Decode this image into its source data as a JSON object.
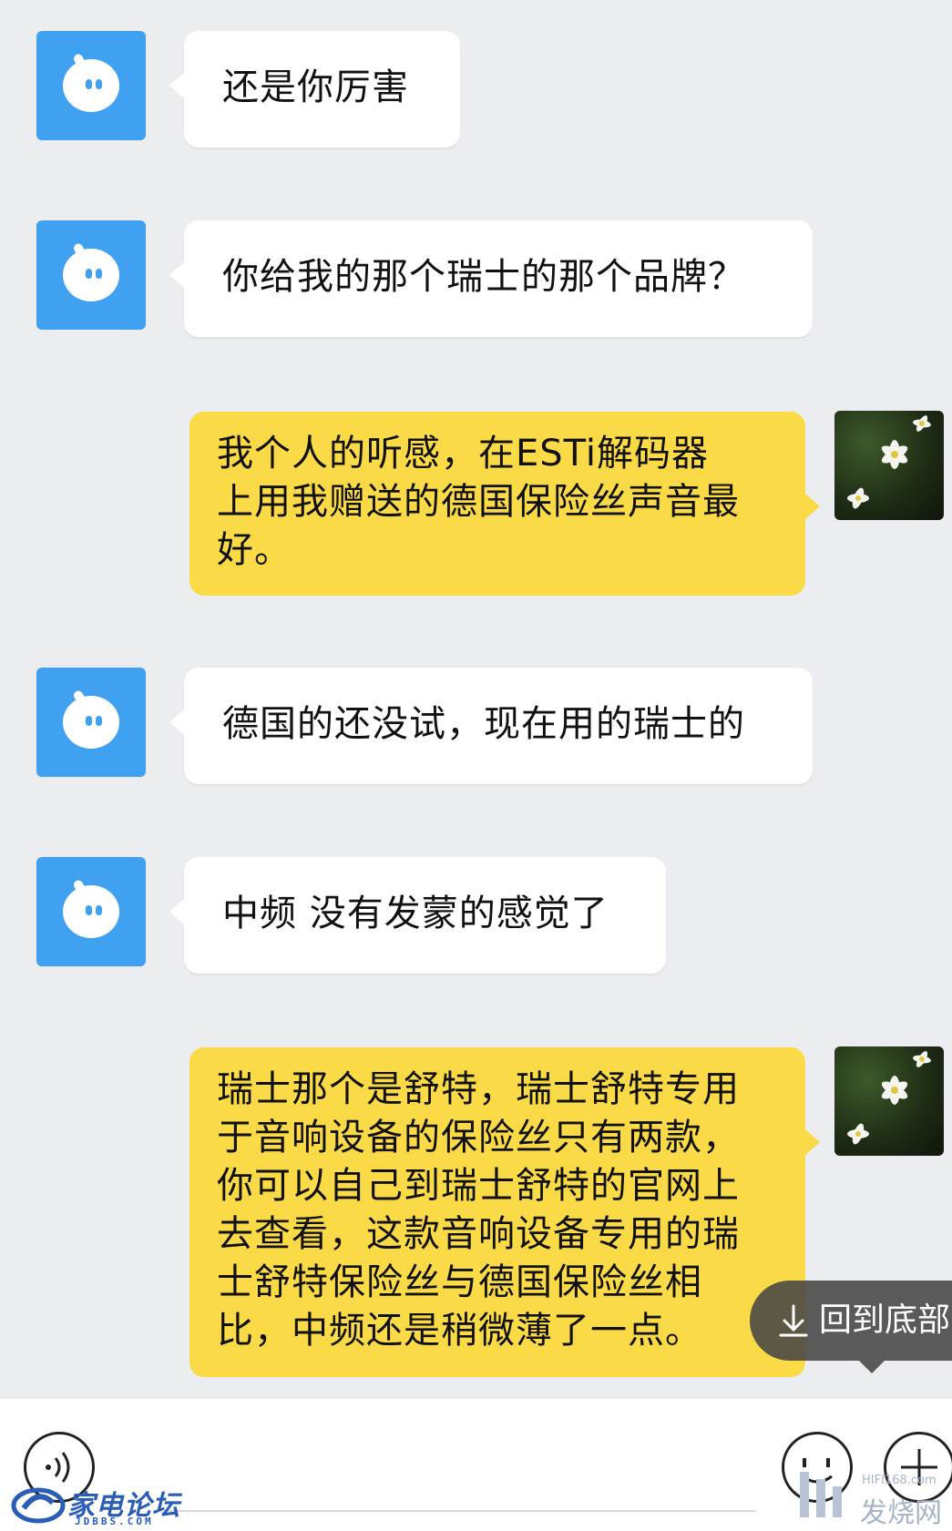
{
  "messages": [
    {
      "side": "in",
      "text": "还是你厉害"
    },
    {
      "side": "in",
      "text": "你给我的那个瑞士的那个品牌？"
    },
    {
      "side": "out",
      "lines": [
        "我个人的听感，在ESTi解码器",
        "上用我赠送的德国保险丝声音最",
        "好。"
      ]
    },
    {
      "side": "in",
      "text": "德国的还没试，现在用的瑞士的"
    },
    {
      "side": "in",
      "text": "中频 没有发蒙的感觉了"
    },
    {
      "side": "out",
      "lines": [
        "瑞士那个是舒特，瑞士舒特专用",
        "于音响设备的保险丝只有两款，",
        "你可以自己到瑞士舒特的官网上",
        "去查看，这款音响设备专用的瑞",
        "士舒特保险丝与德国保险丝相",
        "比，中频还是稍微薄了一点。"
      ]
    }
  ],
  "jump_to_bottom": {
    "label": "回到底部"
  },
  "watermarks": {
    "left_brand": "家电论坛",
    "left_sub": "JDBBS.COM",
    "right_small": "HIFI168.com",
    "right_big": "发烧网"
  },
  "colors": {
    "background": "#ebedf0",
    "bubble_in": "#ffffff",
    "bubble_out": "#fada46",
    "bot_avatar": "#3fa1f0"
  }
}
